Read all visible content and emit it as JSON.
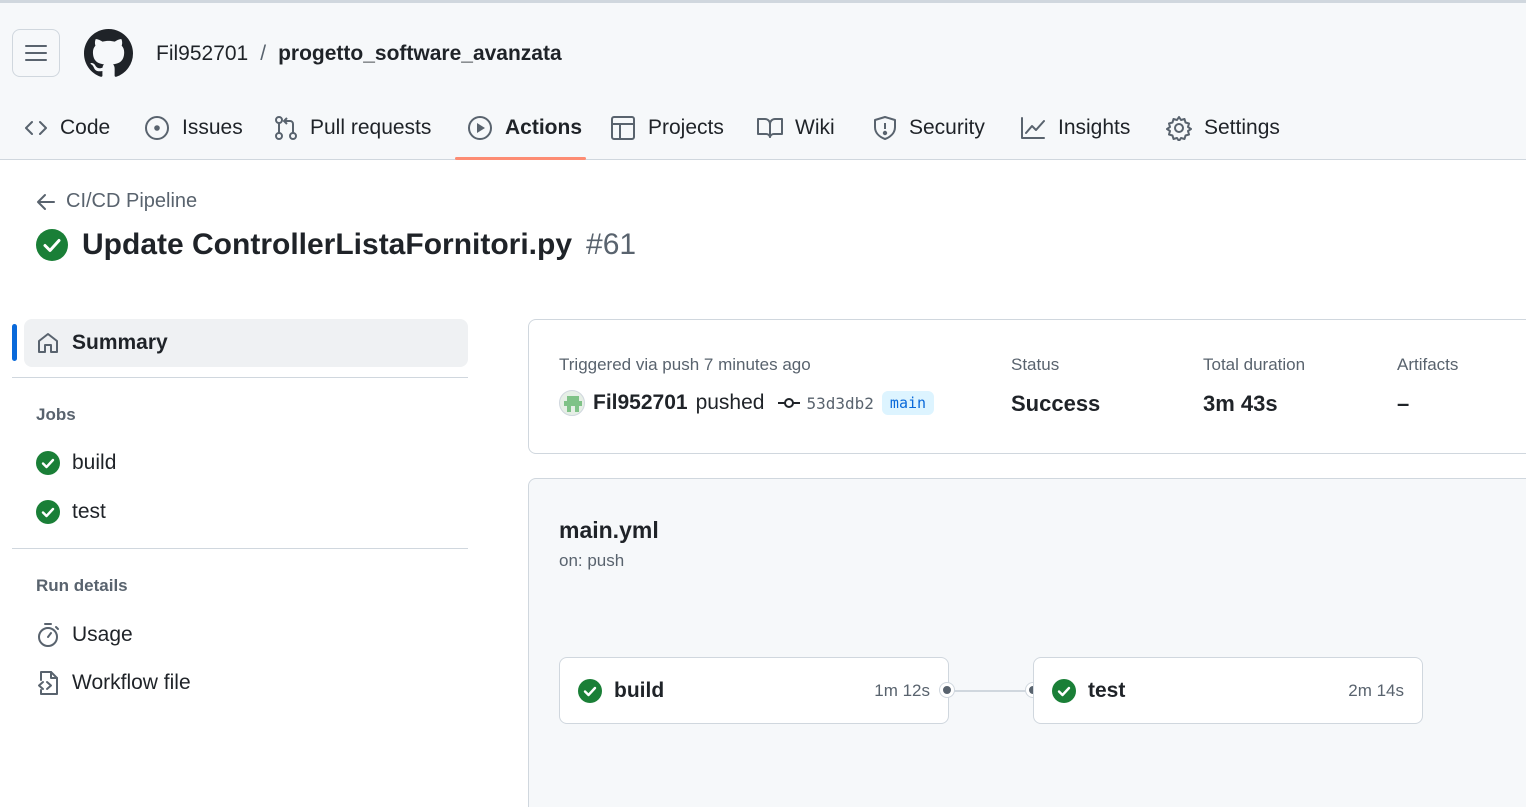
{
  "repo": {
    "owner": "Fil952701",
    "separator": "/",
    "name": "progetto_software_avanzata"
  },
  "tabs": [
    {
      "label": "Code",
      "icon": "code-icon"
    },
    {
      "label": "Issues",
      "icon": "issue-icon"
    },
    {
      "label": "Pull requests",
      "icon": "pull-request-icon"
    },
    {
      "label": "Actions",
      "icon": "play-icon",
      "active": true
    },
    {
      "label": "Projects",
      "icon": "table-icon"
    },
    {
      "label": "Wiki",
      "icon": "book-icon"
    },
    {
      "label": "Security",
      "icon": "shield-icon"
    },
    {
      "label": "Insights",
      "icon": "graph-icon"
    },
    {
      "label": "Settings",
      "icon": "gear-icon"
    }
  ],
  "run": {
    "back_label": "CI/CD Pipeline",
    "title": "Update ControllerListaFornitori.py",
    "number": "#61",
    "status_color": "#1a7f37"
  },
  "sidebar": {
    "summary_label": "Summary",
    "jobs_heading": "Jobs",
    "jobs": [
      {
        "label": "build"
      },
      {
        "label": "test"
      }
    ],
    "run_details_heading": "Run details",
    "details": [
      {
        "label": "Usage",
        "icon": "stopwatch-icon"
      },
      {
        "label": "Workflow file",
        "icon": "file-code-icon"
      }
    ]
  },
  "summary": {
    "trigger_text": "Triggered via push 7 minutes ago",
    "actor": "Fil952701",
    "action": "pushed",
    "commit": "53d3db2",
    "branch": "main",
    "status_label": "Status",
    "status_value": "Success",
    "duration_label": "Total duration",
    "duration_value": "3m 43s",
    "artifacts_label": "Artifacts",
    "artifacts_value": "–"
  },
  "workflow": {
    "file": "main.yml",
    "trigger": "on: push",
    "jobs": [
      {
        "name": "build",
        "duration": "1m 12s"
      },
      {
        "name": "test",
        "duration": "2m 14s"
      }
    ]
  },
  "colors": {
    "accent": "#0969da",
    "success": "#1a7f37",
    "tab_underline": "#fd8c73"
  }
}
